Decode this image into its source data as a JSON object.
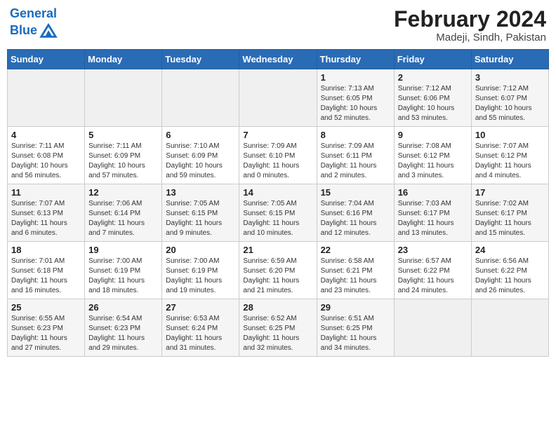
{
  "header": {
    "logo_line1": "General",
    "logo_line2": "Blue",
    "month": "February 2024",
    "location": "Madeji, Sindh, Pakistan"
  },
  "weekdays": [
    "Sunday",
    "Monday",
    "Tuesday",
    "Wednesday",
    "Thursday",
    "Friday",
    "Saturday"
  ],
  "weeks": [
    [
      {
        "day": "",
        "info": ""
      },
      {
        "day": "",
        "info": ""
      },
      {
        "day": "",
        "info": ""
      },
      {
        "day": "",
        "info": ""
      },
      {
        "day": "1",
        "info": "Sunrise: 7:13 AM\nSunset: 6:05 PM\nDaylight: 10 hours\nand 52 minutes."
      },
      {
        "day": "2",
        "info": "Sunrise: 7:12 AM\nSunset: 6:06 PM\nDaylight: 10 hours\nand 53 minutes."
      },
      {
        "day": "3",
        "info": "Sunrise: 7:12 AM\nSunset: 6:07 PM\nDaylight: 10 hours\nand 55 minutes."
      }
    ],
    [
      {
        "day": "4",
        "info": "Sunrise: 7:11 AM\nSunset: 6:08 PM\nDaylight: 10 hours\nand 56 minutes."
      },
      {
        "day": "5",
        "info": "Sunrise: 7:11 AM\nSunset: 6:09 PM\nDaylight: 10 hours\nand 57 minutes."
      },
      {
        "day": "6",
        "info": "Sunrise: 7:10 AM\nSunset: 6:09 PM\nDaylight: 10 hours\nand 59 minutes."
      },
      {
        "day": "7",
        "info": "Sunrise: 7:09 AM\nSunset: 6:10 PM\nDaylight: 11 hours\nand 0 minutes."
      },
      {
        "day": "8",
        "info": "Sunrise: 7:09 AM\nSunset: 6:11 PM\nDaylight: 11 hours\nand 2 minutes."
      },
      {
        "day": "9",
        "info": "Sunrise: 7:08 AM\nSunset: 6:12 PM\nDaylight: 11 hours\nand 3 minutes."
      },
      {
        "day": "10",
        "info": "Sunrise: 7:07 AM\nSunset: 6:12 PM\nDaylight: 11 hours\nand 4 minutes."
      }
    ],
    [
      {
        "day": "11",
        "info": "Sunrise: 7:07 AM\nSunset: 6:13 PM\nDaylight: 11 hours\nand 6 minutes."
      },
      {
        "day": "12",
        "info": "Sunrise: 7:06 AM\nSunset: 6:14 PM\nDaylight: 11 hours\nand 7 minutes."
      },
      {
        "day": "13",
        "info": "Sunrise: 7:05 AM\nSunset: 6:15 PM\nDaylight: 11 hours\nand 9 minutes."
      },
      {
        "day": "14",
        "info": "Sunrise: 7:05 AM\nSunset: 6:15 PM\nDaylight: 11 hours\nand 10 minutes."
      },
      {
        "day": "15",
        "info": "Sunrise: 7:04 AM\nSunset: 6:16 PM\nDaylight: 11 hours\nand 12 minutes."
      },
      {
        "day": "16",
        "info": "Sunrise: 7:03 AM\nSunset: 6:17 PM\nDaylight: 11 hours\nand 13 minutes."
      },
      {
        "day": "17",
        "info": "Sunrise: 7:02 AM\nSunset: 6:17 PM\nDaylight: 11 hours\nand 15 minutes."
      }
    ],
    [
      {
        "day": "18",
        "info": "Sunrise: 7:01 AM\nSunset: 6:18 PM\nDaylight: 11 hours\nand 16 minutes."
      },
      {
        "day": "19",
        "info": "Sunrise: 7:00 AM\nSunset: 6:19 PM\nDaylight: 11 hours\nand 18 minutes."
      },
      {
        "day": "20",
        "info": "Sunrise: 7:00 AM\nSunset: 6:19 PM\nDaylight: 11 hours\nand 19 minutes."
      },
      {
        "day": "21",
        "info": "Sunrise: 6:59 AM\nSunset: 6:20 PM\nDaylight: 11 hours\nand 21 minutes."
      },
      {
        "day": "22",
        "info": "Sunrise: 6:58 AM\nSunset: 6:21 PM\nDaylight: 11 hours\nand 23 minutes."
      },
      {
        "day": "23",
        "info": "Sunrise: 6:57 AM\nSunset: 6:22 PM\nDaylight: 11 hours\nand 24 minutes."
      },
      {
        "day": "24",
        "info": "Sunrise: 6:56 AM\nSunset: 6:22 PM\nDaylight: 11 hours\nand 26 minutes."
      }
    ],
    [
      {
        "day": "25",
        "info": "Sunrise: 6:55 AM\nSunset: 6:23 PM\nDaylight: 11 hours\nand 27 minutes."
      },
      {
        "day": "26",
        "info": "Sunrise: 6:54 AM\nSunset: 6:23 PM\nDaylight: 11 hours\nand 29 minutes."
      },
      {
        "day": "27",
        "info": "Sunrise: 6:53 AM\nSunset: 6:24 PM\nDaylight: 11 hours\nand 31 minutes."
      },
      {
        "day": "28",
        "info": "Sunrise: 6:52 AM\nSunset: 6:25 PM\nDaylight: 11 hours\nand 32 minutes."
      },
      {
        "day": "29",
        "info": "Sunrise: 6:51 AM\nSunset: 6:25 PM\nDaylight: 11 hours\nand 34 minutes."
      },
      {
        "day": "",
        "info": ""
      },
      {
        "day": "",
        "info": ""
      }
    ]
  ]
}
